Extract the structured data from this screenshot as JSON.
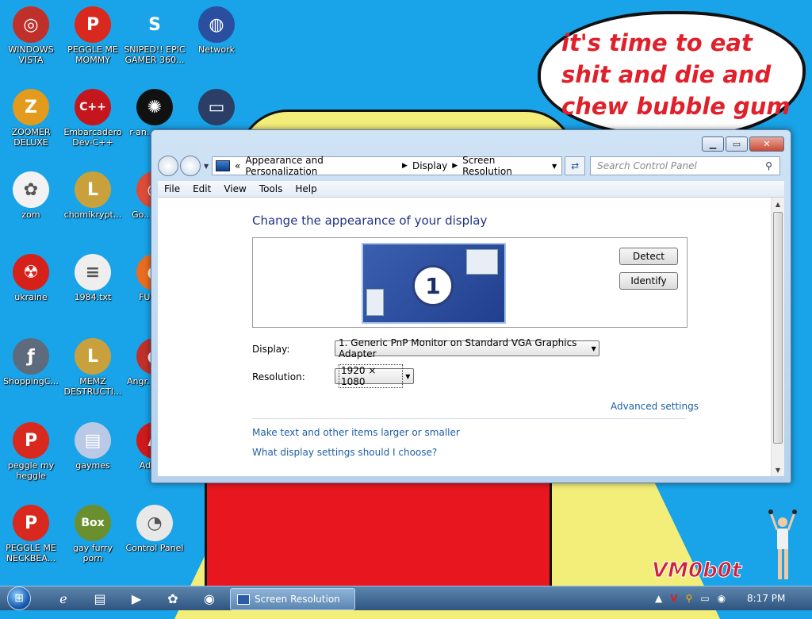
{
  "desktop": {
    "bubble_text": "it's time to eat shit and die and chew bubble gum",
    "signature": "VM0b0t",
    "icons": [
      {
        "label": "WINDOWS VISTA",
        "icon": "vista-icon",
        "color": "#c0302a"
      },
      {
        "label": "PEGGLE ME MOMMY",
        "icon": "peggle-icon",
        "color": "#d9281e"
      },
      {
        "label": "SNIPED!! EPIC GAMER 360...",
        "icon": "skype-icon",
        "color": "#1aa3e8"
      },
      {
        "label": "Network",
        "icon": "network-icon",
        "color": "#2a4fa0"
      },
      {
        "label": "ZOOMER DELUXE",
        "icon": "zoomer-icon",
        "color": "#e39a1d"
      },
      {
        "label": "Embarcadero Dev-C++",
        "icon": "devcpp-icon",
        "color": "#c4161c"
      },
      {
        "label": "r-an... par...",
        "icon": "red-app-icon",
        "color": "#111111"
      },
      {
        "label": "",
        "icon": "tv-icon",
        "color": "#2b3e66"
      },
      {
        "label": "zom",
        "icon": "plant-icon",
        "color": "#f2f2f2"
      },
      {
        "label": "chomikrypt...",
        "icon": "lnk-icon",
        "color": "#c9a13c"
      },
      {
        "label": "Go... Chr...",
        "icon": "chrome-icon",
        "color": "#dd4b39"
      },
      {
        "label": "ukraine",
        "icon": "radiation-icon",
        "color": "#d6201a"
      },
      {
        "label": "1984.txt",
        "icon": "txt-icon",
        "color": "#eeeeee"
      },
      {
        "label": "FURR...",
        "icon": "firefox-icon",
        "color": "#e76c1f"
      },
      {
        "label": "ShoppingC...",
        "icon": "flash-icon",
        "color": "#5d6b7c"
      },
      {
        "label": "MEMZ DESTRUCTI...",
        "icon": "lnk-icon",
        "color": "#c9a13c"
      },
      {
        "label": "Angr... Sea...",
        "icon": "angry-icon",
        "color": "#c0302a"
      },
      {
        "label": "peggle my heggle",
        "icon": "peggle-icon",
        "color": "#d9281e"
      },
      {
        "label": "gaymes",
        "icon": "folder-icon",
        "color": "#b9c9e6"
      },
      {
        "label": "Adob...",
        "icon": "adobe-icon",
        "color": "#cf1a1a"
      },
      {
        "label": "PEGGLE ME NECKBEA...",
        "icon": "peggle-icon",
        "color": "#d9281e"
      },
      {
        "label": "gay furry porn",
        "icon": "box-icon",
        "color": "#6a8f2e"
      },
      {
        "label": "Control Panel",
        "icon": "control-panel-icon",
        "color": "#e8e8e8"
      }
    ]
  },
  "window": {
    "breadcrumb": [
      "«",
      "Appearance and Personalization",
      "Display",
      "Screen Resolution"
    ],
    "search_placeholder": "Search Control Panel",
    "menu": [
      "File",
      "Edit",
      "View",
      "Tools",
      "Help"
    ],
    "heading": "Change the appearance of your display",
    "monitor_number": "1",
    "detect": "Detect",
    "identify": "Identify",
    "display_label": "Display:",
    "display_value": "1. Generic PnP Monitor on Standard VGA Graphics Adapter",
    "resolution_label": "Resolution:",
    "resolution_value": "1920 × 1080",
    "advanced_link": "Advanced settings",
    "link1": "Make text and other items larger or smaller",
    "link2": "What display settings should I choose?"
  },
  "taskbar": {
    "task_label": "Screen Resolution",
    "clock": "8:17 PM"
  }
}
